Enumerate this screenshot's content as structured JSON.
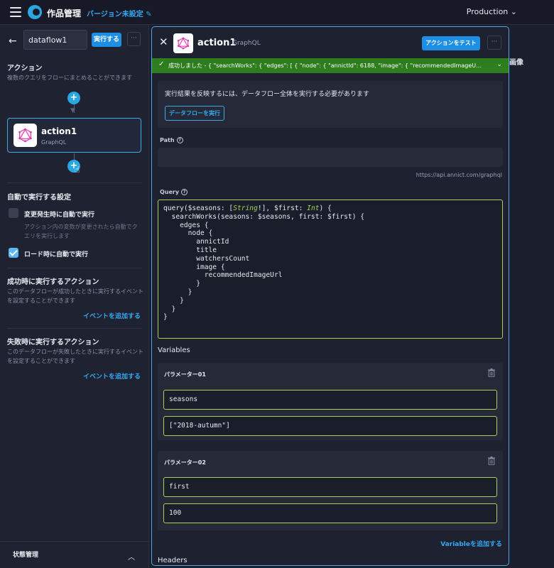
{
  "topbar": {
    "app_title": "作品管理",
    "version_link": "バージョン未設定",
    "environment": "Production"
  },
  "sidebar": {
    "dataflow_name": "dataflow1",
    "run_label": "実行する",
    "more_label": "···",
    "actions_title": "アクション",
    "actions_desc": "複数のクエリをフローにまとめることができます",
    "action_card": {
      "name": "action1",
      "type": "GraphQL"
    },
    "auto_run_title": "自動で実行する設定",
    "on_change": {
      "label": "変更発生時に自動で実行",
      "desc": "アクション内の変数が変更されたら自動でクエリを実行します",
      "checked": false
    },
    "on_load": {
      "label": "ロード時に自動で実行",
      "checked": true
    },
    "on_success": {
      "title": "成功時に実行するアクション",
      "desc": "このデータフローが成功したときに実行するイベントを設定することができます",
      "add_event": "イベントを追加する"
    },
    "on_failure": {
      "title": "失敗時に実行するアクション",
      "desc": "このデータフローが失敗したときに実行するイベントを設定することができます",
      "add_event": "イベントを追加する"
    },
    "state_title": "状態管理"
  },
  "background": {
    "column_header": "画像"
  },
  "panel": {
    "title": "action1",
    "subtitle": "GraphQL",
    "test_button": "アクションをテスト",
    "more_label": "···",
    "success_message": "成功しました - { \"searchWorks\": { \"edges\": [ { \"node\": { \"annictId\": 6188, \"image\": { \"recommendedImageU…",
    "notice_text": "実行結果を反映するには、データフロー全体を実行する必要があります",
    "notice_button": "データフローを実行",
    "path_label": "Path",
    "path_value": "",
    "base_url": "https://api.annict.com/graphql",
    "query_label": "Query",
    "variables_label": "Variables",
    "params": [
      {
        "title": "パラメーター01",
        "name": "seasons",
        "value": "[\"2018-autumn\"]"
      },
      {
        "title": "パラメーター02",
        "name": "first",
        "value": "100"
      }
    ],
    "add_variable": "Variableを追加する",
    "headers_label": "Headers"
  },
  "colors": {
    "accent": "#1c8ee3",
    "success": "#2e7d1e",
    "valid_border": "#a4d35a",
    "panel_border": "#48a9e6"
  }
}
